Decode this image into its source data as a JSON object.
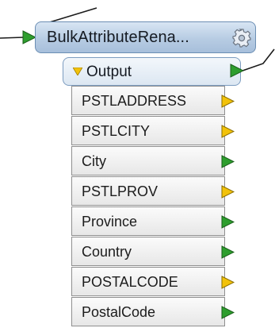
{
  "transformer": {
    "title": "BulkAttributeRena...",
    "settings_icon": "gear-icon",
    "input_port_color": "#2e9e2e"
  },
  "output": {
    "label": "Output",
    "toggle_icon": "triangle-down-icon",
    "port_color": "#2e9e2e"
  },
  "attributes": [
    {
      "name": "PSTLADDRESS",
      "port_color": "#f2c20a"
    },
    {
      "name": "PSTLCITY",
      "port_color": "#f2c20a"
    },
    {
      "name": "City",
      "port_color": "#2e9e2e"
    },
    {
      "name": "PSTLPROV",
      "port_color": "#f2c20a"
    },
    {
      "name": "Province",
      "port_color": "#2e9e2e"
    },
    {
      "name": "Country",
      "port_color": "#2e9e2e"
    },
    {
      "name": "POSTALCODE",
      "port_color": "#f2c20a"
    },
    {
      "name": "PostalCode",
      "port_color": "#2e9e2e"
    }
  ]
}
